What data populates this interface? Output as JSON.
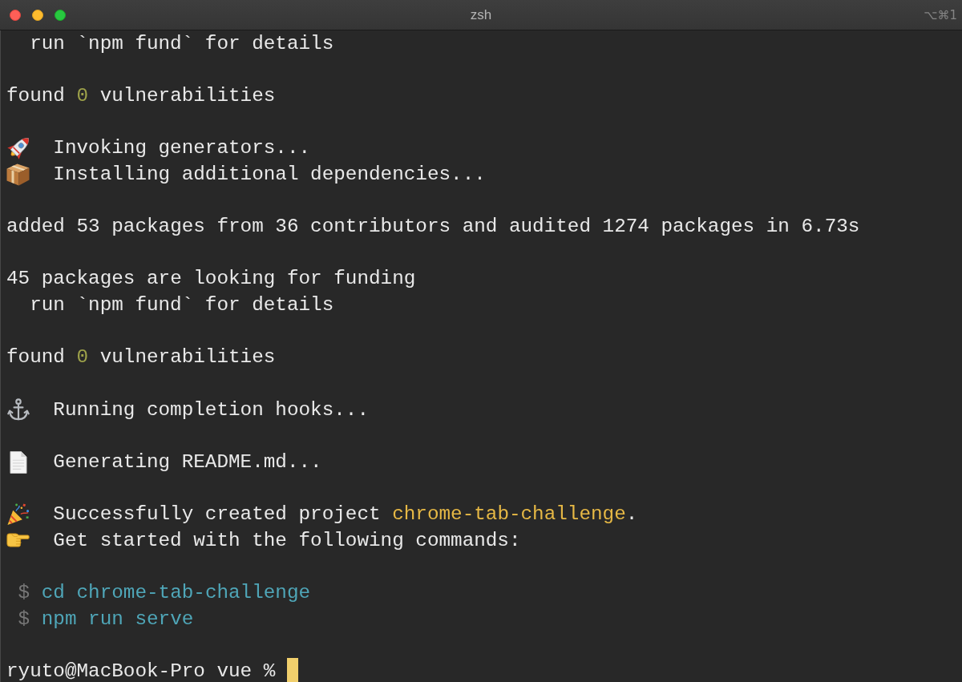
{
  "window": {
    "title": "zsh",
    "shortcut": "⌥⌘1"
  },
  "terminal": {
    "blocks": [
      [
        {
          "kind": "detail",
          "text": "run `npm fund` for details"
        }
      ],
      [
        {
          "kind": "plain",
          "parts": [
            {
              "text": "found "
            },
            {
              "text": "0",
              "color": "#9ea24a"
            },
            {
              "text": " vulnerabilities"
            }
          ]
        }
      ],
      [
        {
          "kind": "invoke",
          "text": "Invoking generators..."
        },
        {
          "kind": "install",
          "text": "Installing additional dependencies..."
        }
      ],
      [
        {
          "kind": "plain",
          "text": "added 53 packages from 36 contributors and audited 1274 packages in 6.73s"
        }
      ],
      [
        {
          "kind": "plain",
          "text": "45 packages are looking for funding"
        },
        {
          "kind": "detail",
          "text": "run `npm fund` for details"
        }
      ],
      [
        {
          "kind": "plain",
          "parts": [
            {
              "text": "found "
            },
            {
              "text": "0",
              "color": "#9ea24a"
            },
            {
              "text": " vulnerabilities"
            }
          ]
        }
      ],
      [
        {
          "kind": "hooks",
          "text": "Running completion hooks..."
        }
      ],
      [
        {
          "kind": "readme",
          "text": "Generating README.md..."
        }
      ],
      [
        {
          "kind": "done",
          "parts": [
            {
              "text": "Successfully created project "
            },
            {
              "text": "chrome-tab-challenge",
              "color": "#e6b845"
            },
            {
              "text": "."
            }
          ]
        },
        {
          "kind": "tip",
          "text": "Get started with the following commands:"
        }
      ],
      [
        {
          "kind": "command",
          "prompt": "$",
          "text": "cd chrome-tab-challenge"
        },
        {
          "kind": "command",
          "prompt": "$",
          "text": "npm run serve"
        }
      ]
    ],
    "prompt": {
      "text": "ryuto@MacBook-Pro vue %",
      "cursor": true
    }
  }
}
